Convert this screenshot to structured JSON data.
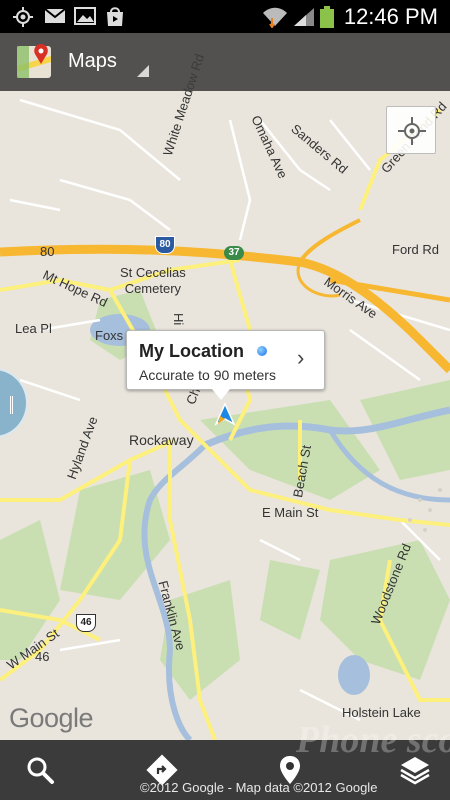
{
  "status_bar": {
    "time": "12:46 PM",
    "icons": [
      "gps-icon",
      "gmail-icon",
      "gallery-icon",
      "play-store-icon",
      "wifi-icon",
      "signal-icon",
      "battery-icon"
    ]
  },
  "action_bar": {
    "title": "Maps",
    "app_icon": "google-maps-icon"
  },
  "map": {
    "road_labels": {
      "white_meadow_rd": "White Meadow Rd",
      "omaha_ave": "Omaha Ave",
      "sanders_rd": "Sanders Rd",
      "green_pond_rd": "Green Pond Rd",
      "ford_rd": "Ford Rd",
      "mt_hope_rd": "Mt Hope Rd",
      "morris_ave": "Morris Ave",
      "lea_pl": "Lea Pl",
      "hylland_ave": "Hyland Ave",
      "beach_st": "Beach St",
      "e_main_st": "E Main St",
      "w_main_st": "W Main St",
      "franklin_ave": "Franklin Ave",
      "woodstone_rd": "Woodstone Rd",
      "hill_partial": "Hi",
      "church_partial": "Chur"
    },
    "place_labels": {
      "cemetery": "St Cecelias\nCemetery",
      "foxs_pond": "Foxs P",
      "rockaway": "Rockaway",
      "holstein_lake": "Holstein Lake"
    },
    "shields": {
      "interstate": "80",
      "route_80_label": "80",
      "route_37": "37",
      "route_46": "46",
      "route_46_label": "46"
    },
    "google_logo": "Google",
    "accent_road_color": "#f7b731",
    "minor_road_color": "#fdf07c",
    "water_color": "#a6bfdd",
    "park_color": "#c9dfb2"
  },
  "my_location": {
    "title": "My Location",
    "subtitle": "Accurate to 90 meters",
    "chevron": "›"
  },
  "bottom_bar": {
    "copyright": "©2012 Google - Map data ©2012 Google",
    "watermark": "Phone scoop",
    "buttons": [
      "search-icon",
      "directions-icon",
      "places-icon",
      "layers-icon"
    ]
  }
}
